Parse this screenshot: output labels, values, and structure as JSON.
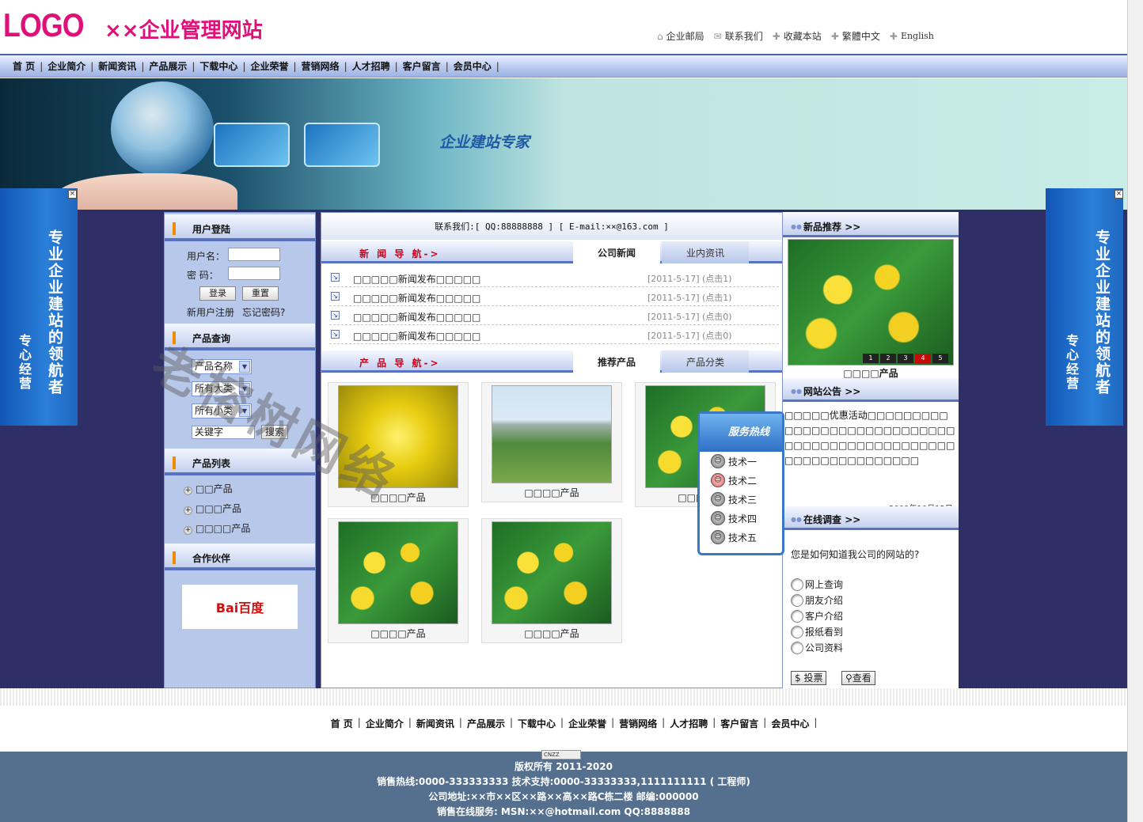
{
  "header": {
    "logo": "LOGO",
    "site_title": "××企业管理网站",
    "toplinks": [
      "企业邮局",
      "联系我们",
      "收藏本站",
      "繁體中文",
      "English"
    ]
  },
  "nav": [
    "首 页",
    "企业简介",
    "新闻资讯",
    "产品展示",
    "下载中心",
    "企业荣誉",
    "营销网络",
    "人才招聘",
    "客户留言",
    "会员中心"
  ],
  "banner": {
    "slogan": "企业建站专家"
  },
  "side_ad": {
    "main": "专业企业建站的领航者",
    "sub": "专心经营",
    "close": "×"
  },
  "left": {
    "login": {
      "title": "用户登陆",
      "user_label": "用户名：",
      "pass_label": "密 码：",
      "login_btn": "登录",
      "reset_btn": "重置",
      "register": "新用户注册",
      "forgot": "忘记密码?"
    },
    "search": {
      "title": "产品查询",
      "field": "产品名称",
      "big_cat": "所有大类",
      "small_cat": "所有小类",
      "keyword_placeholder": "关键字",
      "search_btn": "搜索"
    },
    "product_list": {
      "title": "产品列表",
      "items": [
        "□□产品",
        "□□□产品",
        "□□□□产品"
      ]
    },
    "partners": {
      "title": "合作伙伴",
      "baidu": "Bai百度"
    }
  },
  "mid": {
    "contact": "联系我们:[ QQ:88888888 ] [ E-mail:××@163.com ]",
    "news_nav": {
      "title": "新 闻 导 航->",
      "tabs": [
        "公司新闻",
        "业内资讯"
      ],
      "items": [
        {
          "title": "□□□□□新闻发布□□□□□",
          "date": "[2011-5-17]",
          "hits": "(点击1)"
        },
        {
          "title": "□□□□□新闻发布□□□□□",
          "date": "[2011-5-17]",
          "hits": "(点击1)"
        },
        {
          "title": "□□□□□新闻发布□□□□□",
          "date": "[2011-5-17]",
          "hits": "(点击0)"
        },
        {
          "title": "□□□□□新闻发布□□□□□",
          "date": "[2011-5-17]",
          "hits": "(点击0)"
        }
      ]
    },
    "product_nav": {
      "title": "产 品 导 航->",
      "tabs": [
        "推荐产品",
        "产品分类"
      ],
      "items": [
        "□□□□产品",
        "□□□□产品",
        "□□□□产品",
        "□□□□产品",
        "□□□□产品"
      ]
    }
  },
  "hotline": {
    "title": "服务热线",
    "techs": [
      "技术一",
      "技术二",
      "技术三",
      "技术四",
      "技术五"
    ]
  },
  "right": {
    "new_products": {
      "title": "新品推荐",
      "caption": "□□□□产品",
      "slides": [
        "1",
        "2",
        "3",
        "4",
        "5"
      ],
      "active_slide": 4
    },
    "notice": {
      "title": "网站公告",
      "text": "□□□□□优惠活动□□□□□□□□□□□□□□□□□□□□□□□□□□□□□□□□□□□□□□□□□□□□□□□□□□□□□□□□□□□□□□",
      "date": "2009年10月12日"
    },
    "survey": {
      "title": "在线调查",
      "question": "您是如何知道我公司的网站的?",
      "options": [
        "网上查询",
        "朋友介绍",
        "客户介绍",
        "报纸看到",
        "公司资料"
      ],
      "vote_btn": "投票",
      "view_btn": "查看"
    }
  },
  "footer": {
    "nav": [
      "首 页",
      "企业简介",
      "新闻资讯",
      "产品展示",
      "下载中心",
      "企业荣誉",
      "营销网络",
      "人才招聘",
      "客户留言",
      "会员中心"
    ],
    "cnzz": "CNZZ",
    "lines": [
      "版权所有 2011-2020",
      "销售热线:0000-333333333 技术支持:0000-33333333,1111111111 ( 工程师)",
      "公司地址:××市××区××路××高××路C栋二楼 邮编:000000",
      "销售在线服务: MSN:××@hotmail.com QQ:8888888"
    ]
  },
  "watermark": "老榕树网络",
  "colors": {
    "brand": "#e0107a",
    "nav": "#b9c9ef",
    "sidebar": "#2f2f68",
    "footer": "#54708e"
  }
}
